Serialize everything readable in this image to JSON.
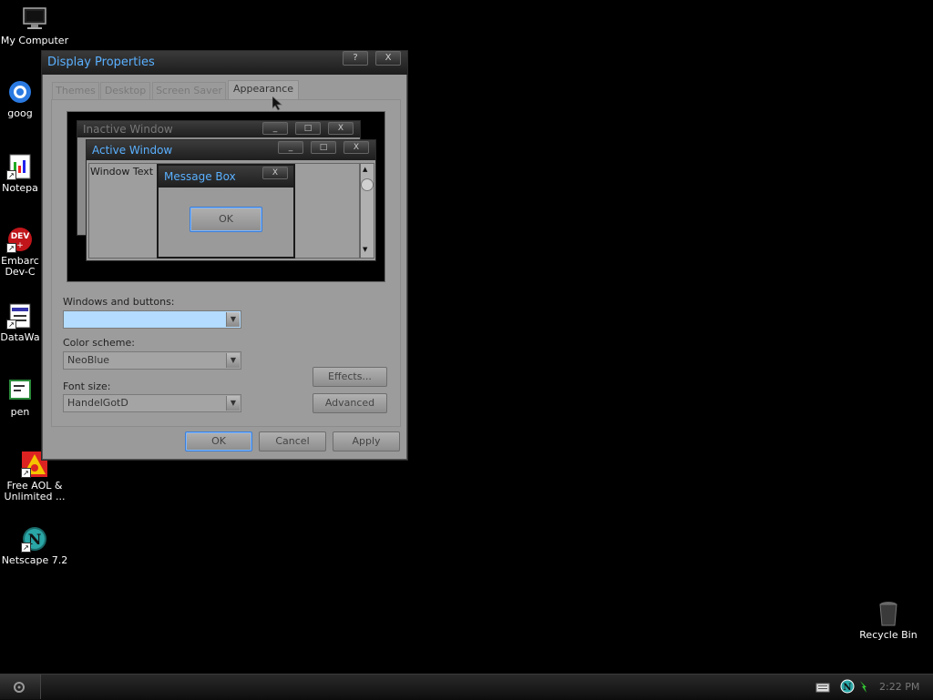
{
  "desktop": {
    "icons": [
      {
        "label": "My Computer",
        "icon": "monitor-icon"
      },
      {
        "label": "goog",
        "icon": "google-icon"
      },
      {
        "label": "Notepa",
        "icon": "notepad-icon"
      },
      {
        "label_line1": "Embarc",
        "label_line2": "Dev-C",
        "icon": "devcpp-icon",
        "badge": "DEV"
      },
      {
        "label": "DataWa",
        "icon": "datawatch-icon"
      },
      {
        "label": "pen",
        "icon": "pen-icon"
      },
      {
        "label_line1": "Free AOL &",
        "label_line2": "Unlimited ...",
        "icon": "aol-icon"
      },
      {
        "label": "Netscape 7.2",
        "icon": "netscape-icon",
        "glyph": "N"
      }
    ],
    "recycle_bin": {
      "label": "Recycle Bin",
      "icon": "trash-icon"
    }
  },
  "dialog": {
    "title": "Display Properties",
    "help_label": "?",
    "close_label": "X",
    "tabs": [
      {
        "label": "Themes",
        "active": false
      },
      {
        "label": "Desktop",
        "active": false
      },
      {
        "label": "Screen Saver",
        "active": false
      },
      {
        "label": "Appearance",
        "active": true
      }
    ],
    "preview": {
      "inactive_title": "Inactive Window",
      "active_title": "Active Window",
      "window_text": "Window Text",
      "message_title": "Message Box",
      "ok_label": "OK",
      "min_label": "_",
      "max_label": "□",
      "close_label": "X",
      "scroll_up": "▲",
      "scroll_down": "▼"
    },
    "windows_buttons": {
      "label": "Windows and buttons:",
      "value": ""
    },
    "color_scheme": {
      "label": "Color scheme:",
      "value": "NeoBlue"
    },
    "font_size": {
      "label": "Font size:",
      "value": "HandelGotD"
    },
    "effects_label": "Effects...",
    "advanced_label": "Advanced",
    "ok_label": "OK",
    "cancel_label": "Cancel",
    "apply_label": "Apply"
  },
  "taskbar": {
    "clock": "2:22 PM"
  },
  "colors": {
    "title_text": "#5ab0ff",
    "selection": "#b3dcff",
    "desktop": "#000000"
  }
}
